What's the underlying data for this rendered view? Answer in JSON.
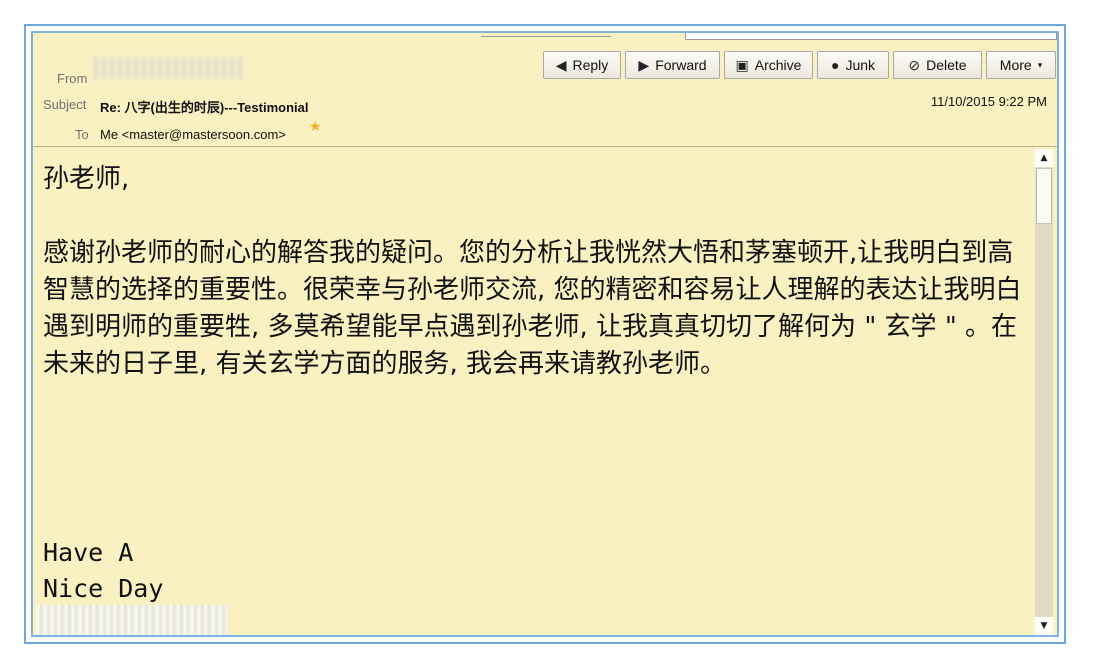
{
  "header": {
    "from_label": "From",
    "subject_label": "Subject",
    "subject": "Re: 八字(出生的时辰)---Testimonial",
    "date": "11/10/2015 9:22 PM",
    "to_label": "To",
    "to": "Me <master@mastersoon.com>"
  },
  "toolbar": {
    "reply": "Reply",
    "forward": "Forward",
    "archive": "Archive",
    "junk": "Junk",
    "delete": "Delete",
    "more": "More"
  },
  "body": {
    "greeting": "孙老师,",
    "paragraph": "感谢孙老师的耐心的解答我的疑问。您的分析让我恍然大悟和茅塞顿开,让我明白到高智慧的选择的重要性。很荣幸与孙老师交流, 您的精密和容易让人理解的表达让我明白遇到明师的重要牲, 多莫希望能早点遇到孙老师, 让我真真切切了解何为 \" 玄学 \" 。在未来的日子里, 有关玄学方面的服务, 我会再来请教孙老师。",
    "sign_line1": "Have A",
    "sign_line2": "Nice Day"
  },
  "icons": {
    "reply": "reply-arrow-icon",
    "forward": "forward-arrow-icon",
    "archive": "archive-box-icon",
    "junk": "flame-icon",
    "delete": "delete-circle-icon",
    "more": "dropdown-caret-icon",
    "star": "star-icon"
  }
}
